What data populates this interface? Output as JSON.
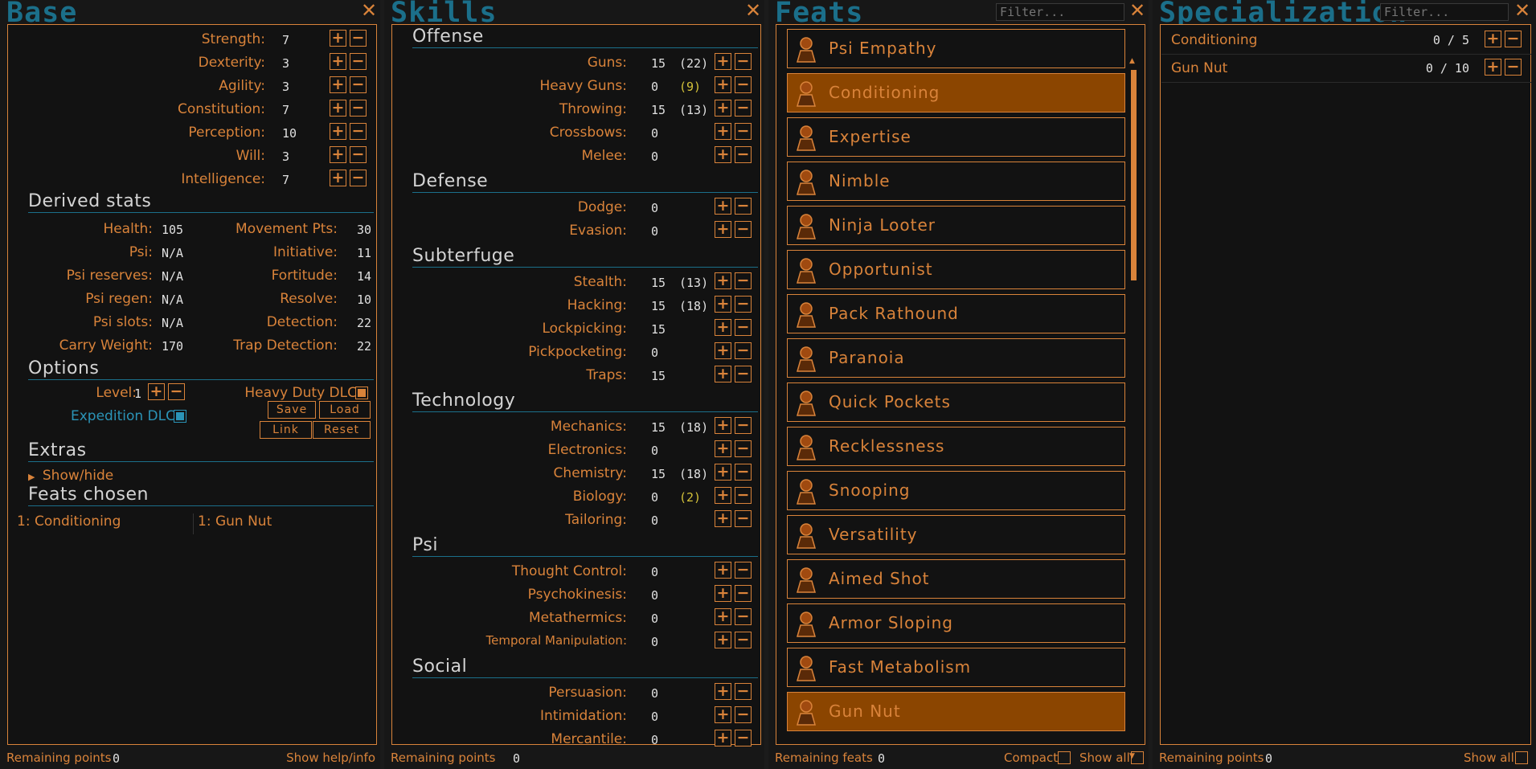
{
  "panels": {
    "base": "Base",
    "skills": "Skills",
    "feats": "Feats",
    "spec": "Specialization"
  },
  "filter_placeholder": "Filter...",
  "base": {
    "attrs": [
      {
        "label": "Strength:",
        "value": "7"
      },
      {
        "label": "Dexterity:",
        "value": "3"
      },
      {
        "label": "Agility:",
        "value": "3"
      },
      {
        "label": "Constitution:",
        "value": "7"
      },
      {
        "label": "Perception:",
        "value": "10"
      },
      {
        "label": "Will:",
        "value": "3"
      },
      {
        "label": "Intelligence:",
        "value": "7"
      }
    ],
    "derived_title": "Derived stats",
    "derived_left": [
      {
        "label": "Health:",
        "value": "105"
      },
      {
        "label": "Psi:",
        "value": "N/A"
      },
      {
        "label": "Psi reserves:",
        "value": "N/A"
      },
      {
        "label": "Psi regen:",
        "value": "N/A"
      },
      {
        "label": "Psi slots:",
        "value": "N/A"
      },
      {
        "label": "Carry Weight:",
        "value": "170"
      }
    ],
    "derived_right": [
      {
        "label": "Movement Pts:",
        "value": "30"
      },
      {
        "label": "Initiative:",
        "value": "11"
      },
      {
        "label": "Fortitude:",
        "value": "14"
      },
      {
        "label": "Resolve:",
        "value": "10"
      },
      {
        "label": "Detection:",
        "value": "22"
      },
      {
        "label": "Trap Detection:",
        "value": "22"
      }
    ],
    "options_title": "Options",
    "level_label": "Level:",
    "level_value": "1",
    "heavy_duty": "Heavy Duty DLC",
    "expedition": "Expedition DLC",
    "save": "Save",
    "load": "Load",
    "link": "Link",
    "reset": "Reset",
    "extras_title": "Extras",
    "showhide": "Show/hide",
    "feats_chosen_title": "Feats chosen",
    "chosen": [
      "1: Conditioning",
      "1: Gun Nut"
    ],
    "remaining_label": "Remaining points",
    "remaining_value": "0",
    "help": "Show help/info"
  },
  "skills": {
    "sections": [
      {
        "title": "Offense",
        "rows": [
          {
            "label": "Guns:",
            "value": "15",
            "bonus": "(22)",
            "b": ""
          },
          {
            "label": "Heavy Guns:",
            "value": "0",
            "bonus": "(9)",
            "b": "y"
          },
          {
            "label": "Throwing:",
            "value": "15",
            "bonus": "(13)",
            "b": ""
          },
          {
            "label": "Crossbows:",
            "value": "0",
            "bonus": "",
            "b": ""
          },
          {
            "label": "Melee:",
            "value": "0",
            "bonus": "",
            "b": ""
          }
        ]
      },
      {
        "title": "Defense",
        "rows": [
          {
            "label": "Dodge:",
            "value": "0",
            "bonus": "",
            "b": ""
          },
          {
            "label": "Evasion:",
            "value": "0",
            "bonus": "",
            "b": ""
          }
        ]
      },
      {
        "title": "Subterfuge",
        "rows": [
          {
            "label": "Stealth:",
            "value": "15",
            "bonus": "(13)",
            "b": ""
          },
          {
            "label": "Hacking:",
            "value": "15",
            "bonus": "(18)",
            "b": ""
          },
          {
            "label": "Lockpicking:",
            "value": "15",
            "bonus": "",
            "b": ""
          },
          {
            "label": "Pickpocketing:",
            "value": "0",
            "bonus": "",
            "b": ""
          },
          {
            "label": "Traps:",
            "value": "15",
            "bonus": "",
            "b": ""
          }
        ]
      },
      {
        "title": "Technology",
        "rows": [
          {
            "label": "Mechanics:",
            "value": "15",
            "bonus": "(18)",
            "b": ""
          },
          {
            "label": "Electronics:",
            "value": "0",
            "bonus": "",
            "b": ""
          },
          {
            "label": "Chemistry:",
            "value": "15",
            "bonus": "(18)",
            "b": ""
          },
          {
            "label": "Biology:",
            "value": "0",
            "bonus": "(2)",
            "b": "y"
          },
          {
            "label": "Tailoring:",
            "value": "0",
            "bonus": "",
            "b": ""
          }
        ]
      },
      {
        "title": "Psi",
        "rows": [
          {
            "label": "Thought Control:",
            "value": "0",
            "bonus": "",
            "b": ""
          },
          {
            "label": "Psychokinesis:",
            "value": "0",
            "bonus": "",
            "b": ""
          },
          {
            "label": "Metathermics:",
            "value": "0",
            "bonus": "",
            "b": ""
          },
          {
            "label": "Temporal Manipulation:",
            "value": "0",
            "bonus": "",
            "b": ""
          }
        ]
      },
      {
        "title": "Social",
        "rows": [
          {
            "label": "Persuasion:",
            "value": "0",
            "bonus": "",
            "b": ""
          },
          {
            "label": "Intimidation:",
            "value": "0",
            "bonus": "",
            "b": ""
          },
          {
            "label": "Mercantile:",
            "value": "0",
            "bonus": "",
            "b": ""
          }
        ]
      }
    ],
    "remaining_label": "Remaining points",
    "remaining_value": "0"
  },
  "feats": {
    "items": [
      {
        "name": "Psi Empathy",
        "sel": false,
        "icon": "psi-empathy-icon"
      },
      {
        "name": "Conditioning",
        "sel": true,
        "icon": "conditioning-icon"
      },
      {
        "name": "Expertise",
        "sel": false,
        "icon": "expertise-icon"
      },
      {
        "name": "Nimble",
        "sel": false,
        "icon": "nimble-icon"
      },
      {
        "name": "Ninja Looter",
        "sel": false,
        "icon": "ninja-looter-icon"
      },
      {
        "name": "Opportunist",
        "sel": false,
        "icon": "opportunist-icon"
      },
      {
        "name": "Pack Rathound",
        "sel": false,
        "icon": "pack-rathound-icon"
      },
      {
        "name": "Paranoia",
        "sel": false,
        "icon": "paranoia-icon"
      },
      {
        "name": "Quick Pockets",
        "sel": false,
        "icon": "quick-pockets-icon"
      },
      {
        "name": "Recklessness",
        "sel": false,
        "icon": "recklessness-icon"
      },
      {
        "name": "Snooping",
        "sel": false,
        "icon": "snooping-icon"
      },
      {
        "name": "Versatility",
        "sel": false,
        "icon": "versatility-icon"
      },
      {
        "name": "Aimed Shot",
        "sel": false,
        "icon": "aimed-shot-icon"
      },
      {
        "name": "Armor Sloping",
        "sel": false,
        "icon": "armor-sloping-icon"
      },
      {
        "name": "Fast Metabolism",
        "sel": false,
        "icon": "fast-metabolism-icon"
      },
      {
        "name": "Gun Nut",
        "sel": true,
        "icon": "gun-nut-icon"
      }
    ],
    "remaining_label": "Remaining feats",
    "remaining_value": "0",
    "compact": "Compact",
    "showall": "Show all"
  },
  "spec": {
    "items": [
      {
        "name": "Conditioning",
        "value": "0 / 5"
      },
      {
        "name": "Gun Nut",
        "value": "0 / 10"
      }
    ],
    "remaining_label": "Remaining points",
    "remaining_value": "0",
    "showall": "Show all"
  },
  "colors": {
    "accent": "#d9833a",
    "selected": "#8b4500",
    "title": "#1b6f8a",
    "yellow": "#d4c23a"
  }
}
